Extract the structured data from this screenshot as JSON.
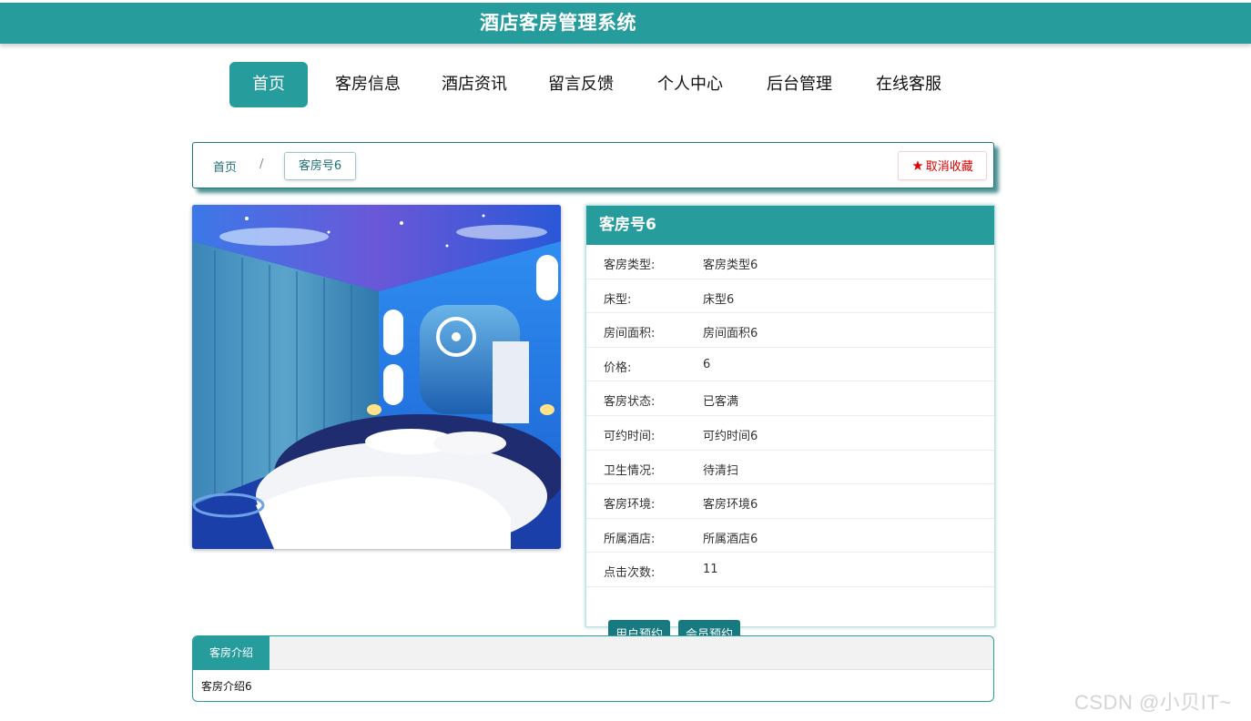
{
  "header": {
    "title": "酒店客房管理系统"
  },
  "nav": {
    "items": [
      {
        "label": "首页",
        "active": true
      },
      {
        "label": "客房信息",
        "active": false
      },
      {
        "label": "酒店资讯",
        "active": false
      },
      {
        "label": "留言反馈",
        "active": false
      },
      {
        "label": "个人中心",
        "active": false
      },
      {
        "label": "后台管理",
        "active": false
      },
      {
        "label": "在线客服",
        "active": false
      }
    ]
  },
  "breadcrumb": {
    "home": "首页",
    "separator": "/",
    "current": "客房号6"
  },
  "favorite": {
    "label": "取消收藏",
    "icon": "star-icon",
    "color": "#e00000"
  },
  "room": {
    "title": "客房号6",
    "fields": [
      {
        "label": "客房类型:",
        "value": "客房类型6"
      },
      {
        "label": "床型:",
        "value": "床型6"
      },
      {
        "label": "房间面积:",
        "value": "房间面积6"
      },
      {
        "label": "价格:",
        "value": "6"
      },
      {
        "label": "客房状态:",
        "value": "已客满"
      },
      {
        "label": "可约时间:",
        "value": "可约时间6"
      },
      {
        "label": "卫生情况:",
        "value": "待清扫"
      },
      {
        "label": "客房环境:",
        "value": "客房环境6"
      },
      {
        "label": "所属酒店:",
        "value": "所属酒店6"
      },
      {
        "label": "点击次数:",
        "value": "11"
      }
    ],
    "buttons": {
      "user_booking": "用户预约",
      "member_booking": "会员预约"
    }
  },
  "intro": {
    "tab_label": "客房介绍",
    "content": "客房介绍6"
  },
  "watermark": "CSDN @小贝IT~",
  "colors": {
    "primary": "#279c9c",
    "button": "#177a80",
    "favorite": "#e00000"
  }
}
